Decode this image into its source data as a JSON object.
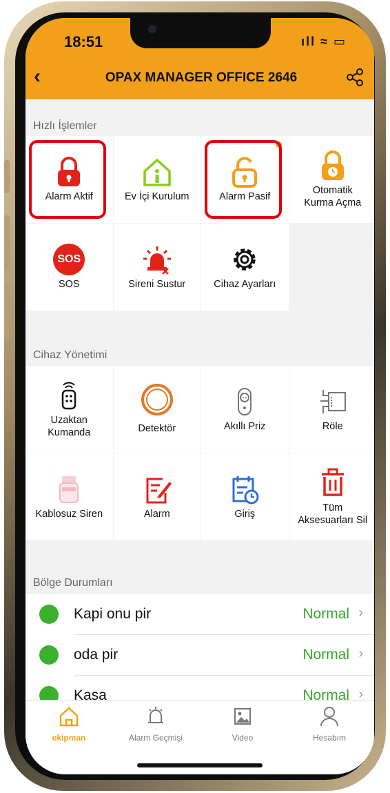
{
  "status_bar": {
    "time": "18:51",
    "icons": "ıll ≈ ▭"
  },
  "header": {
    "back": "‹",
    "title": "OPAX MANAGER OFFICE 2646",
    "share_icon": "share-icon"
  },
  "quick_actions": {
    "label": "Hızlı İşlemler",
    "items": [
      {
        "label": "Alarm Aktif",
        "icon": "🔒"
      },
      {
        "label": "Ev İçi Kurulum",
        "icon": "⌂"
      },
      {
        "label": "Alarm Pasif",
        "icon": "🔓"
      },
      {
        "label": "Otomatik\nKurma Açma",
        "icon": "⏲"
      },
      {
        "label": "SOS",
        "icon": "SOS"
      },
      {
        "label": "Sireni Sustur",
        "icon": "🚨"
      },
      {
        "label": "Cihaz Ayarları",
        "icon": "⚙"
      }
    ]
  },
  "device_management": {
    "label": "Cihaz Yönetimi",
    "items": [
      {
        "label": "Uzaktan\nKumanda",
        "icon": "📡"
      },
      {
        "label": "Detektör",
        "icon": "◯"
      },
      {
        "label": "Akıllı Priz",
        "icon": "⏻"
      },
      {
        "label": "Röle",
        "icon": "⊞"
      },
      {
        "label": "Kablosuz Siren",
        "icon": "▣"
      },
      {
        "label": "Alarm",
        "icon": "✎"
      },
      {
        "label": "Giriş",
        "icon": "📅"
      },
      {
        "label": "Tüm\nAksesuarları Sil",
        "icon": "🗑"
      }
    ]
  },
  "zones": {
    "label": "Bölge Durumları",
    "items": [
      {
        "name": "Kapi onu pir",
        "status": "Normal"
      },
      {
        "name": "oda pir",
        "status": "Normal"
      },
      {
        "name": "Kasa",
        "status": "Normal"
      }
    ]
  },
  "tabbar": {
    "items": [
      {
        "label": "ekipman",
        "icon": "⌂"
      },
      {
        "label": "Alarm Geçmişi",
        "icon": "🔔"
      },
      {
        "label": "Video",
        "icon": "🖼"
      },
      {
        "label": "Hesabım",
        "icon": "👤"
      }
    ]
  },
  "colors": {
    "accent": "#f2a01a",
    "highlight": "#e0000b",
    "status_ok": "#3aa52d",
    "active_red": "#e2231a"
  }
}
